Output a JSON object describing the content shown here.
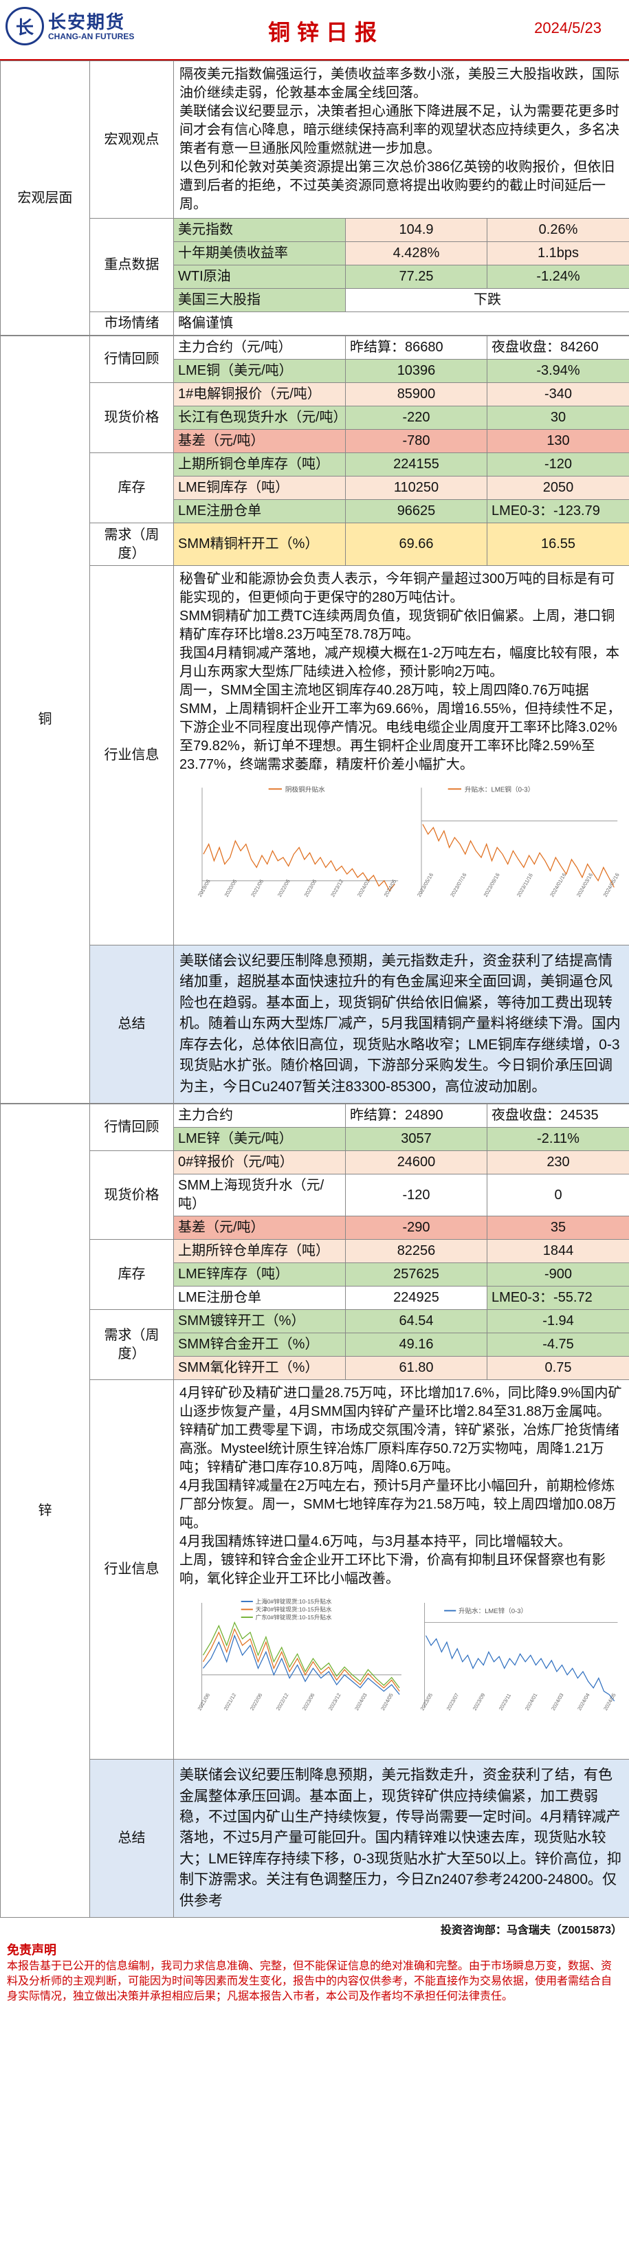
{
  "header": {
    "brand": "长安期货",
    "brand_en": "CHANG-AN FUTURES",
    "title": "铜锌日报",
    "date": "2024/5/23"
  },
  "macro": {
    "section": "宏观层面",
    "view_label": "宏观观点",
    "view_text": [
      "隔夜美元指数偏强运行，美债收益率多数小涨，美股三大股指收跌，国际油价继续走弱，伦敦基本金属全线回落。",
      "美联储会议纪要显示，决策者担心通胀下降进展不足，认为需要花更多时间才会有信心降息，暗示继续保持高利率的观望状态应持续更久，多名决策者有意一旦通胀风险重燃就进一步加息。",
      "以色列和伦敦对英美资源提出第三次总价386亿英镑的收购报价，但依旧遭到后者的拒绝，不过英美资源同意将提出收购要约的截止时间延后一周。"
    ],
    "key_label": "重点数据",
    "key_rows": [
      {
        "name": "美元指数",
        "v1": "104.9",
        "v2": "0.26%"
      },
      {
        "name": "十年期美债收益率",
        "v1": "4.428%",
        "v2": "1.1bps"
      },
      {
        "name": "WTI原油",
        "v1": "77.25",
        "v2": "-1.24%"
      },
      {
        "name": "美国三大股指",
        "v1": "",
        "v2": "下跌"
      }
    ],
    "mood_label": "市场情绪",
    "mood_value": "略偏谨慎"
  },
  "copper": {
    "section": "铜",
    "review_label": "行情回顾",
    "r1": {
      "name": "主力合约（元/吨）",
      "a": "昨结算：86680",
      "b": "夜盘收盘：84260"
    },
    "r2": {
      "name": "LME铜（美元/吨）",
      "a": "10396",
      "b": "-3.94%"
    },
    "spot_label": "现货价格",
    "s1": {
      "name": "1#电解铜报价（元/吨）",
      "a": "85900",
      "b": "-340"
    },
    "s2": {
      "name": "长江有色现货升水（元/吨）",
      "a": "-220",
      "b": "30"
    },
    "s3": {
      "name": "基差（元/吨）",
      "a": "-780",
      "b": "130"
    },
    "inv_label": "库存",
    "i1": {
      "name": "上期所铜仓单库存（吨）",
      "a": "224155",
      "b": "-120"
    },
    "i2": {
      "name": "LME铜库存（吨）",
      "a": "110250",
      "b": "2050"
    },
    "i3": {
      "name": "LME注册仓单",
      "a": "96625",
      "b": "LME0-3：-123.79"
    },
    "demand_label": "需求（周度）",
    "d1": {
      "name": "SMM精铜杆开工（%）",
      "a": "69.66",
      "b": "16.55"
    },
    "info_label": "行业信息",
    "info_text": [
      "秘鲁矿业和能源协会负责人表示，今年铜产量超过300万吨的目标是有可能实现的，但更倾向于更保守的280万吨估计。",
      "SMM铜精矿加工费TC连续两周负值，现货铜矿依旧偏紧。上周，港口铜精矿库存环比增8.23万吨至78.78万吨。",
      "我国4月精铜减产落地，减产规模大概在1-2万吨左右，幅度比较有限，本月山东两家大型炼厂陆续进入检修，预计影响2万吨。",
      "周一，SMM全国主流地区铜库存40.28万吨，较上周四降0.76万吨据SMM，上周精铜杆企业开工率为69.66%，周增16.55%，但持续性不足，下游企业不同程度出现停产情况。电线电缆企业周度开工率环比降3.02%至79.82%，新订单不理想。再生铜杆企业周度开工率环比降2.59%至23.77%，终端需求萎靡，精废杆价差小幅扩大。"
    ],
    "charts": {
      "left_legend": "阴极铜升贴水",
      "right_legend": "升贴水：LME铜（0-3）"
    },
    "chart_data": [
      {
        "type": "line",
        "series": [
          {
            "name": "阴极铜升贴水",
            "values": []
          }
        ]
      },
      {
        "type": "line",
        "series": [
          {
            "name": "升贴水：LME铜（0-3）",
            "values": []
          }
        ]
      }
    ],
    "summary_label": "总结",
    "summary": "美联储会议纪要压制降息预期，美元指数走升，资金获利了结提高情绪加重，超脱基本面快速拉升的有色金属迎来全面回调，美铜逼仓风险也在趋弱。基本面上，现货铜矿供给依旧偏紧，等待加工费出现转机。随着山东两大型炼厂减产，5月我国精铜产量料将继续下滑。国内库存去化，总体依旧高位，现货贴水略收窄；LME铜库存继续增，0-3现货贴水扩张。随价格回调，下游部分采购发生。今日铜价承压回调为主，今日Cu2407暂关注83300-85300，高位波动加剧。"
  },
  "zinc": {
    "section": "锌",
    "review_label": "行情回顾",
    "r1": {
      "name": "主力合约",
      "a": "昨结算：24890",
      "b": "夜盘收盘：24535"
    },
    "r2": {
      "name": "LME锌（美元/吨）",
      "a": "3057",
      "b": "-2.11%"
    },
    "spot_label": "现货价格",
    "s1": {
      "name": "0#锌报价（元/吨）",
      "a": "24600",
      "b": "230"
    },
    "s2": {
      "name": "SMM上海现货升水（元/吨）",
      "a": "-120",
      "b": "0"
    },
    "s3": {
      "name": "基差（元/吨）",
      "a": "-290",
      "b": "35"
    },
    "inv_label": "库存",
    "i1": {
      "name": "上期所锌仓单库存（吨）",
      "a": "82256",
      "b": "1844"
    },
    "i2": {
      "name": "LME锌库存（吨）",
      "a": "257625",
      "b": "-900"
    },
    "i3": {
      "name": "LME注册仓单",
      "a": "224925",
      "b": "LME0-3：-55.72"
    },
    "demand_label": "需求（周度）",
    "d1": {
      "name": "SMM镀锌开工（%）",
      "a": "64.54",
      "b": "-1.94"
    },
    "d2": {
      "name": "SMM锌合金开工（%）",
      "a": "49.16",
      "b": "-4.75"
    },
    "d3": {
      "name": "SMM氧化锌开工（%）",
      "a": "61.80",
      "b": "0.75"
    },
    "info_label": "行业信息",
    "info_text": [
      "4月锌矿砂及精矿进口量28.75万吨，环比增加17.6%，同比降9.9%国内矿山逐步恢复产量，4月SMM国内锌矿产量环比增2.84至31.88万金属吨。锌精矿加工费零星下调，市场成交氛围冷清，锌矿紧张，冶炼厂抢货情绪高涨。Mysteel统计原生锌冶炼厂原料库存50.72万实物吨，周降1.21万吨；锌精矿港口库存10.8万吨，周降0.6万吨。",
      "4月我国精锌减量在2万吨左右，预计5月产量环比小幅回升，前期检修炼厂部分恢复。周一，SMM七地锌库存为21.58万吨，较上周四增加0.08万吨。",
      "4月我国精炼锌进口量4.6万吨，与3月基本持平，同比增幅较大。",
      "上周，镀锌和锌合金企业开工环比下滑，价高有抑制且环保督察也有影响，氧化锌企业开工环比小幅改善。"
    ],
    "charts": {
      "left_legends": [
        "上海0#锌锭现货:10-15升贴水",
        "天津0#锌锭现货:10-15升贴水",
        "广东0#锌锭现货:10-15升贴水"
      ],
      "right_legend": "升贴水：LME锌（0-3）"
    },
    "chart_data": [
      {
        "type": "line",
        "series": [
          {
            "name": "上海0#锌锭现货:10-15升贴水",
            "values": []
          },
          {
            "name": "天津0#锌锭现货:10-15升贴水",
            "values": []
          },
          {
            "name": "广东0#锌锭现货:10-15升贴水",
            "values": []
          }
        ]
      },
      {
        "type": "line",
        "series": [
          {
            "name": "升贴水：LME锌（0-3）",
            "values": []
          }
        ]
      }
    ],
    "summary_label": "总结",
    "summary": "美联储会议纪要压制降息预期，美元指数走升，资金获利了结，有色金属整体承压回调。基本面上，现货锌矿供应持续偏紧，加工费弱稳，不过国内矿山生产持续恢复，传导尚需要一定时间。4月精锌减产落地，不过5月产量可能回升。国内精锌难以快速去库，现货贴水较大；LME锌库存持续下移，0-3现货贴水扩大至50以上。锌价高位，抑制下游需求。关注有色调整压力，今日Zn2407参考24200-24800。仅供参考"
  },
  "footer": {
    "author": "投资咨询部：马含瑞夫（Z0015873）",
    "disclaimer_title": "免责声明",
    "disclaimer": "本报告基于已公开的信息编制，我司力求信息准确、完整，但不能保证信息的绝对准确和完整。由于市场瞬息万变，数据、资料及分析师的主观判断，可能因为时间等因素而发生变化，报告中的内容仅供参考，不能直接作为交易依据，使用者需结合自身实际情况，独立做出决策并承担相应后果；凡据本报告入市者，本公司及作者均不承担任何法律责任。"
  }
}
